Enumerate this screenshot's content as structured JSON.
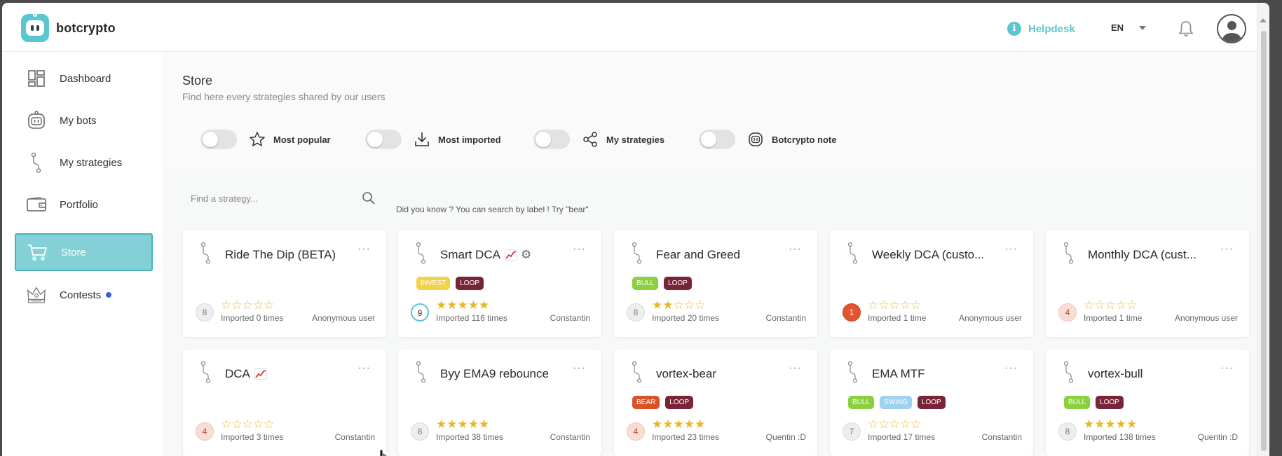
{
  "header": {
    "logo_text": "botcrypto",
    "helpdesk_label": "Helpdesk",
    "info_glyph": "i",
    "language": "EN"
  },
  "sidebar": {
    "items": [
      {
        "label": "Dashboard",
        "icon": "dashboard-icon"
      },
      {
        "label": "My bots",
        "icon": "bot-icon"
      },
      {
        "label": "My strategies",
        "icon": "strategy-icon"
      },
      {
        "label": "Portfolio",
        "icon": "wallet-icon"
      },
      {
        "label": "Store",
        "icon": "cart-icon",
        "active": true
      },
      {
        "label": "Contests",
        "icon": "crown-icon",
        "notification_dot": true
      }
    ]
  },
  "store": {
    "title": "Store",
    "subtitle": "Find here every strategies shared by our users",
    "filters": [
      {
        "label": "Most popular",
        "icon": "star-icon",
        "on": false
      },
      {
        "label": "Most imported",
        "icon": "download-icon",
        "on": false
      },
      {
        "label": "My strategies",
        "icon": "share-icon",
        "on": false
      },
      {
        "label": "Botcrypto note",
        "icon": "bot-icon",
        "on": false
      }
    ],
    "search_placeholder": "Find a strategy...",
    "hint": "Did you know ? You can search by label ! Try \"bear\"",
    "menu_glyph": "···"
  },
  "colors": {
    "accent": "#5bc6cf",
    "active_bg": "#83d0d6",
    "star": "#e8b82a",
    "invest": "#f1d34a",
    "loop": "#7a2438",
    "bull": "#8ccf3f",
    "bear": "#d9522a",
    "swing": "#9ed2ee"
  },
  "cards": [
    {
      "title": "Ride The Dip (BETA)",
      "labels": [],
      "score": "8",
      "score_style": "gray",
      "rating": 0,
      "imported": "Imported 0 times",
      "author": "Anonymous user"
    },
    {
      "title": "Smart DCA",
      "chart_emoji": true,
      "gear": true,
      "labels": [
        "INVEST",
        "LOOP"
      ],
      "score": "9",
      "score_style": "teal",
      "rating": 5,
      "imported": "Imported 116 times",
      "author": "Constantin"
    },
    {
      "title": "Fear and Greed",
      "labels": [
        "BULL",
        "LOOP"
      ],
      "score": "8",
      "score_style": "gray",
      "rating": 2,
      "imported": "Imported 20 times",
      "author": "Constantin"
    },
    {
      "title": "Weekly DCA (custo...",
      "labels": [],
      "score": "1",
      "score_style": "red",
      "rating": 0,
      "imported": "Imported 1 time",
      "author": "Anonymous user"
    },
    {
      "title": "Monthly DCA (cust...",
      "labels": [],
      "score": "4",
      "score_style": "pink",
      "rating": 0,
      "imported": "Imported 1 time",
      "author": "Anonymous user"
    },
    {
      "title": "DCA",
      "chart_emoji": true,
      "labels": [],
      "score": "4",
      "score_style": "pink",
      "rating": 0,
      "imported": "Imported 3 times",
      "author": "Constantin"
    },
    {
      "title": "Byy EMA9 rebounce",
      "labels": [],
      "score": "8",
      "score_style": "gray",
      "rating": 5,
      "imported": "Imported 38 times",
      "author": "Constantin"
    },
    {
      "title": "vortex-bear",
      "labels": [
        "BEAR",
        "LOOP"
      ],
      "score": "4",
      "score_style": "pink",
      "rating": 5,
      "imported": "Imported 23 times",
      "author": "Quentin :D"
    },
    {
      "title": "EMA MTF",
      "labels": [
        "BULL",
        "SWING",
        "LOOP"
      ],
      "score": "7",
      "score_style": "gray",
      "rating": 0,
      "imported": "Imported 17 times",
      "author": "Constantin"
    },
    {
      "title": "vortex-bull",
      "labels": [
        "BULL",
        "LOOP"
      ],
      "score": "8",
      "score_style": "gray",
      "rating": 5,
      "imported": "Imported 138 times",
      "author": "Quentin :D"
    }
  ]
}
